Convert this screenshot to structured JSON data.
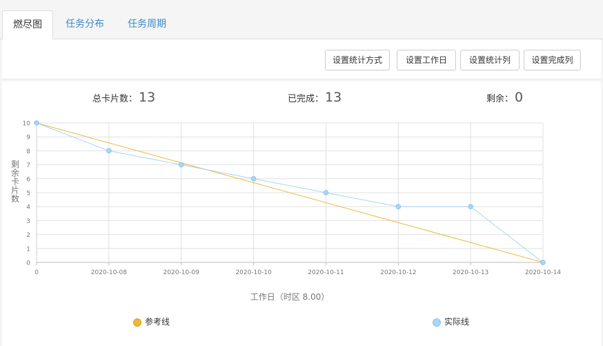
{
  "tabs": [
    {
      "label": "燃尽图",
      "active": true
    },
    {
      "label": "任务分布",
      "active": false
    },
    {
      "label": "任务周期",
      "active": false
    }
  ],
  "toolbar": {
    "buttons": [
      "设置统计方式",
      "设置工作日",
      "设置统计列",
      "设置完成列"
    ]
  },
  "stats": {
    "total_label": "总卡片数：",
    "total_value": "13",
    "done_label": "已完成：",
    "done_value": "13",
    "remain_label": "剩余：",
    "remain_value": "0"
  },
  "colors": {
    "reference": "#eab93a",
    "actual": "#a7d4f4",
    "actual_marker": "#a9d6f5",
    "grid": "#e0e0e0",
    "axis_text": "#777777"
  },
  "chart_data": {
    "type": "line",
    "x": [
      "0",
      "2020-10-08",
      "2020-10-09",
      "2020-10-10",
      "2020-10-11",
      "2020-10-12",
      "2020-10-13",
      "2020-10-14"
    ],
    "series": [
      {
        "name": "参考线",
        "values": [
          10,
          null,
          null,
          null,
          null,
          null,
          null,
          0
        ]
      },
      {
        "name": "实际线",
        "values": [
          10,
          8,
          7,
          6,
          5,
          4,
          4,
          0
        ]
      }
    ],
    "xlabel": "工作日（时区 8.00）",
    "ylabel": "剩余卡片数",
    "ylim": [
      0,
      10
    ],
    "yticks": [
      0,
      1,
      2,
      3,
      4,
      5,
      6,
      7,
      8,
      9,
      10
    ],
    "grid": true,
    "legend": "bottom"
  }
}
